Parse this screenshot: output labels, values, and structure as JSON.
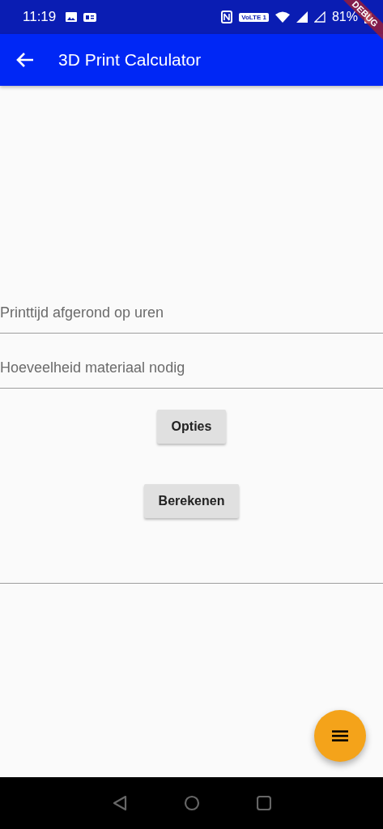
{
  "status_bar": {
    "time": "11:19",
    "network_badge": "VoLTE 1",
    "battery": "81%"
  },
  "debug_banner": "DEBUG",
  "app_bar": {
    "title": "3D Print Calculator"
  },
  "fields": [
    {
      "placeholder": "Printtijd afgerond op uren"
    },
    {
      "placeholder": "Hoeveelheid materiaal nodig"
    }
  ],
  "buttons": [
    {
      "label": "Opties"
    },
    {
      "label": "Berekenen"
    }
  ]
}
